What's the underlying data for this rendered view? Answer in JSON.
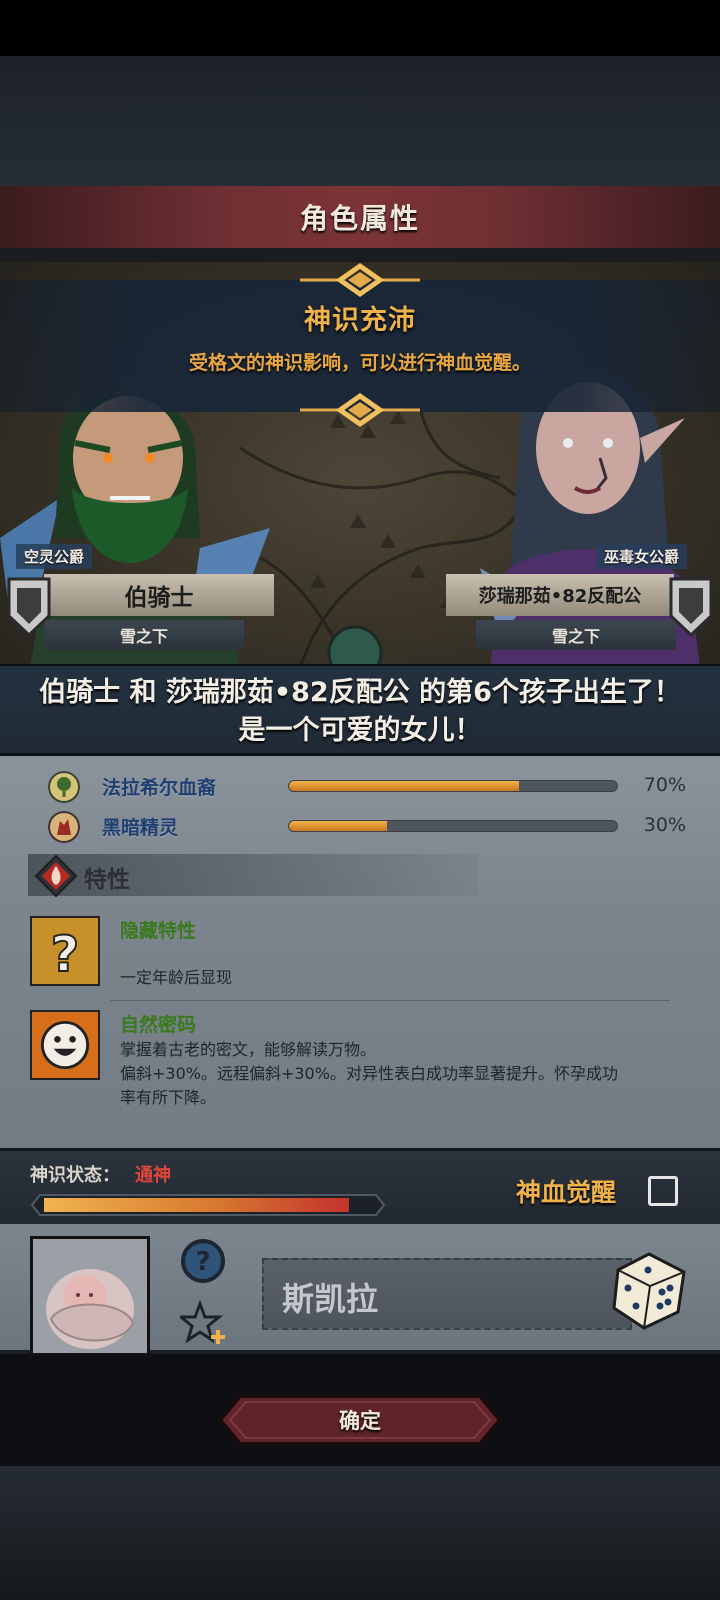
{
  "header": {
    "title": "角色属性"
  },
  "banner": {
    "title": "神识充沛",
    "description": "受格文的神识影响，可以进行神血觉醒。"
  },
  "father": {
    "title_tag": "空灵公爵",
    "name": "伯骑士",
    "house": "雪之下"
  },
  "mother": {
    "title_tag": "巫毒女公爵",
    "name": "莎瑞那茹•82反配公",
    "house": "雪之下"
  },
  "message": {
    "line1": "伯骑士 和 莎瑞那茹•82反配公 的第6个孩子出生了！",
    "line2": "是一个可爱的女儿！"
  },
  "bloodlines": [
    {
      "name": "法拉希尔血裔",
      "percent_label": "70%",
      "value": 0.7,
      "icon": "tree-emblem-icon"
    },
    {
      "name": "黑暗精灵",
      "percent_label": "30%",
      "value": 0.3,
      "icon": "dark-elf-emblem-icon"
    }
  ],
  "traits_section": {
    "title": "特性"
  },
  "traits": [
    {
      "name": "隐藏特性",
      "desc_lines": [
        "一定年龄后显现"
      ],
      "icon": "question-mark-icon"
    },
    {
      "name": "自然密码",
      "desc_lines": [
        "掌握着古老的密文，能够解读万物。",
        "偏斜+30%。远程偏斜+30%。对异性表白成功率显著提升。怀孕成功",
        "率有所下降。"
      ],
      "icon": "smiley-face-icon"
    }
  ],
  "status": {
    "label": "神识状态：",
    "value": "通神",
    "fill": 0.93,
    "awaken_label": "神血觉醒",
    "awaken_checked": false
  },
  "child": {
    "name": "斯凯拉",
    "icons": [
      "question-circle-icon",
      "star-plus-icon",
      "dice-icon"
    ]
  },
  "confirm": {
    "label": "确定"
  },
  "colors": {
    "accent_orange": "#f0b24a",
    "status_red": "#e2453a",
    "trait_green": "#3a7a1d",
    "bloodline_blue": "#1f3e72"
  }
}
